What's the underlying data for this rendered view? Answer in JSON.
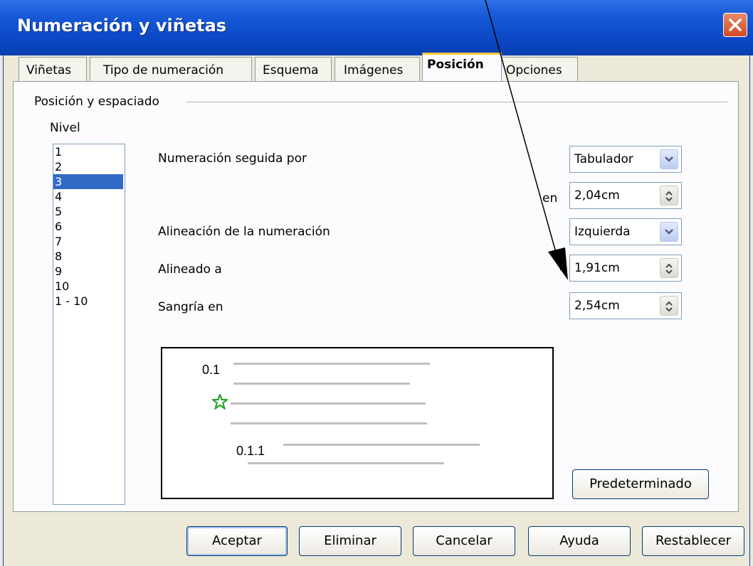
{
  "window": {
    "title": "Numeración y viñetas"
  },
  "tabs": [
    {
      "label": "Viñetas",
      "active": false
    },
    {
      "label": "Tipo de numeración",
      "active": false
    },
    {
      "label": "Esquema",
      "active": false
    },
    {
      "label": "Imágenes",
      "active": false
    },
    {
      "label": "Posición",
      "active": true
    },
    {
      "label": "Opciones",
      "active": false
    }
  ],
  "section": {
    "legend": "Posición y espaciado",
    "level_label": "Nivel",
    "levels": [
      "1",
      "2",
      "3",
      "4",
      "5",
      "6",
      "7",
      "8",
      "9",
      "10",
      "1 - 10"
    ],
    "selected_level": "3"
  },
  "fields": {
    "numbering_followed_by": {
      "label": "Numeración seguida por",
      "value": "Tabulador"
    },
    "at": {
      "label": "en",
      "value": "2,04cm"
    },
    "numbering_alignment": {
      "label": "Alineación de la numeración",
      "value": "Izquierda"
    },
    "aligned_at": {
      "label": "Alineado a",
      "value": "1,91cm"
    },
    "indent_at": {
      "label": "Sangría en",
      "value": "2,54cm"
    }
  },
  "preview": {
    "item1": "0.1",
    "item3": "0.1.1",
    "bullet_color": "#2aa52a"
  },
  "buttons": {
    "default": "Predeterminado",
    "ok": "Aceptar",
    "delete": "Eliminar",
    "cancel": "Cancelar",
    "help": "Ayuda",
    "reset": "Restablecer"
  }
}
